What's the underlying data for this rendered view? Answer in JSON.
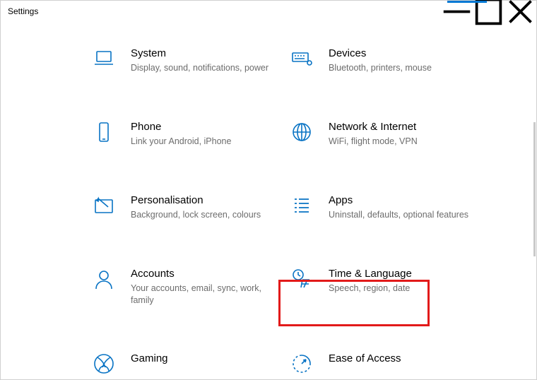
{
  "window": {
    "title": "Settings"
  },
  "colors": {
    "accent": "#0078d4",
    "icon": "#0873c4",
    "highlight": "#e21a1a",
    "subtext": "#6c6c6c"
  },
  "highlighted_category": "Time & Language",
  "categories": [
    {
      "id": "system",
      "title": "System",
      "subtitle": "Display, sound, notifications, power"
    },
    {
      "id": "devices",
      "title": "Devices",
      "subtitle": "Bluetooth, printers, mouse"
    },
    {
      "id": "phone",
      "title": "Phone",
      "subtitle": "Link your Android, iPhone"
    },
    {
      "id": "network",
      "title": "Network & Internet",
      "subtitle": "WiFi, flight mode, VPN"
    },
    {
      "id": "personalisation",
      "title": "Personalisation",
      "subtitle": "Background, lock screen, colours"
    },
    {
      "id": "apps",
      "title": "Apps",
      "subtitle": "Uninstall, defaults, optional features"
    },
    {
      "id": "accounts",
      "title": "Accounts",
      "subtitle": "Your accounts, email, sync, work, family"
    },
    {
      "id": "time-language",
      "title": "Time & Language",
      "subtitle": "Speech, region, date"
    },
    {
      "id": "gaming",
      "title": "Gaming",
      "subtitle": ""
    },
    {
      "id": "ease-of-access",
      "title": "Ease of Access",
      "subtitle": ""
    }
  ]
}
